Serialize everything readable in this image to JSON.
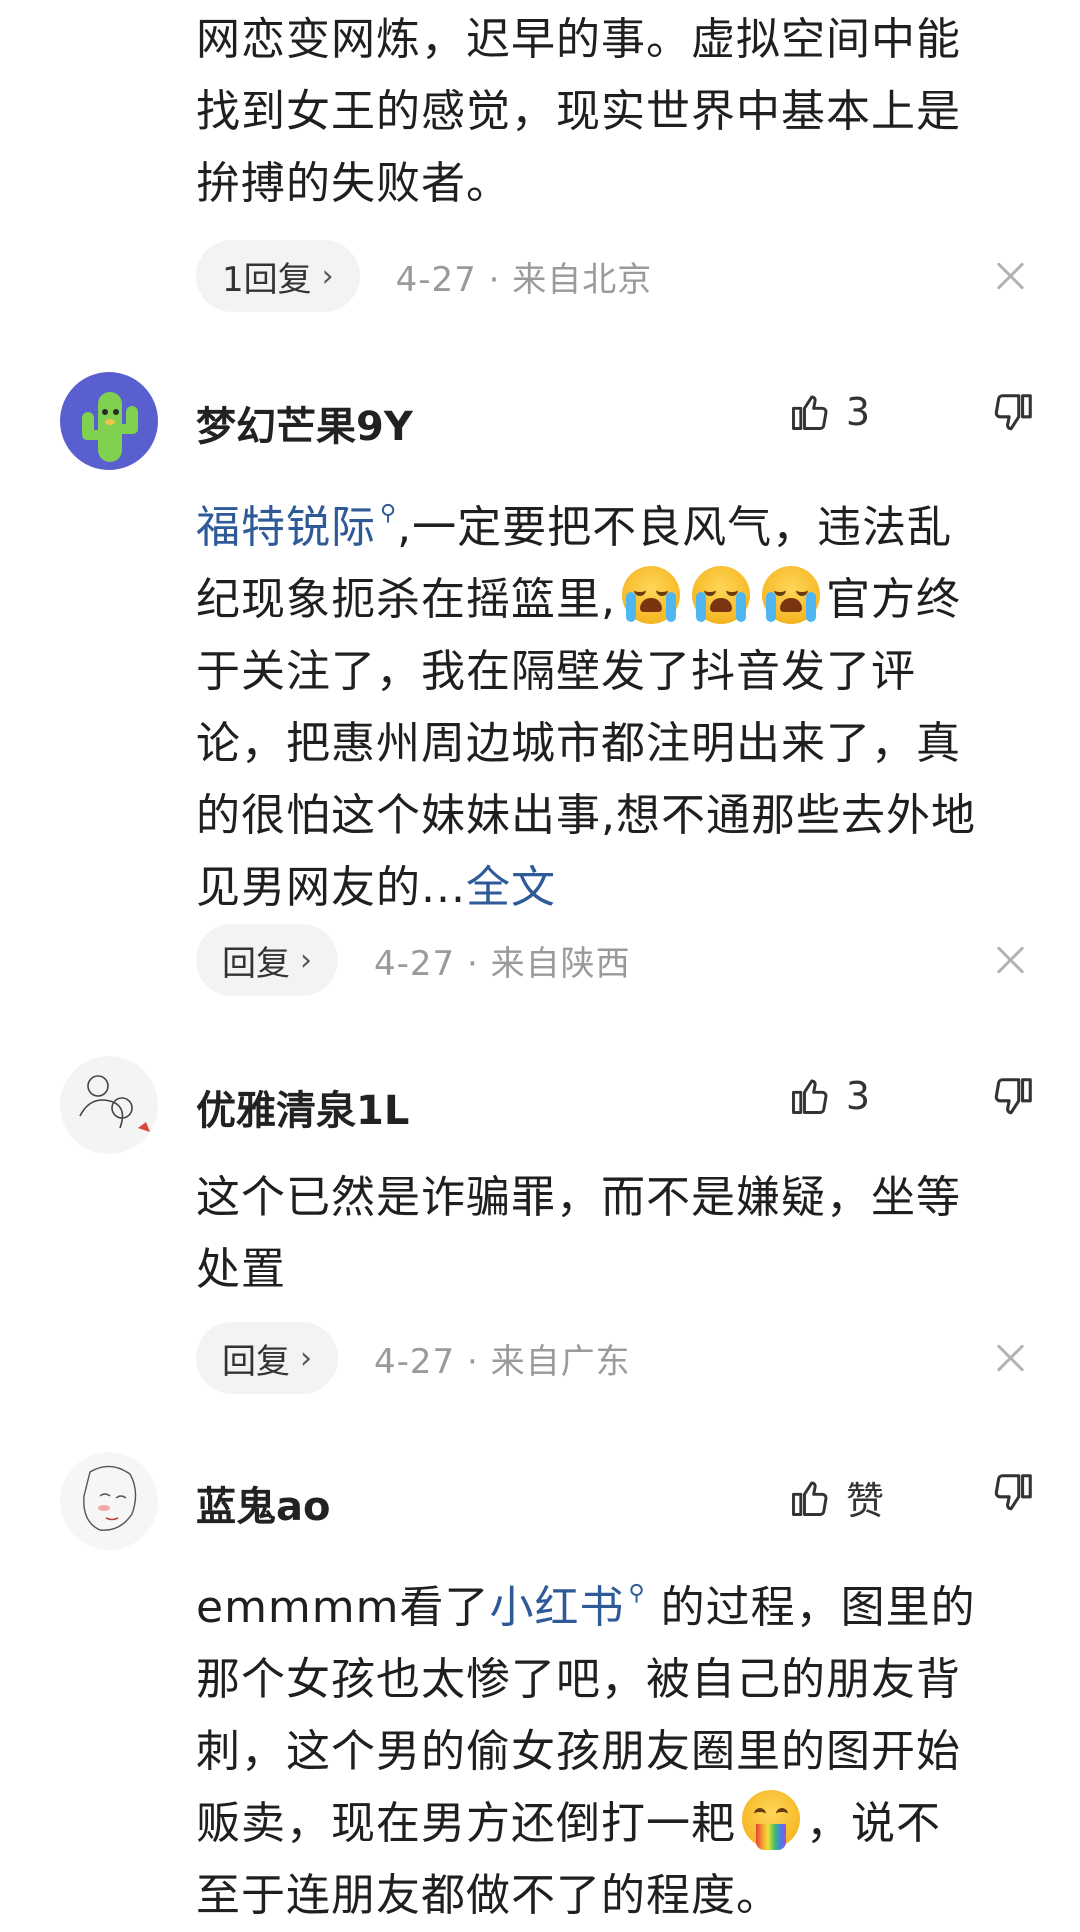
{
  "top_comment": {
    "lines": [
      "网恋变网炼，迟早的事。虚拟空间中能",
      "找到女王的感觉，现实世界中基本上是",
      "拚搏的失败者。"
    ],
    "reply_label": "1回复",
    "meta": "4-27 · 来自北京"
  },
  "comments": [
    {
      "username": "梦幻芒果9Y",
      "likes": "3",
      "link_text": "福特锐际",
      "line1_rest": ",一定要把不良风气，违法乱",
      "line2_pre": "纪现象扼杀在摇篮里,",
      "line2_post": "官方终",
      "line3": "于关注了，我在隔壁发了抖音发了评",
      "line4": "论，把惠州周边城市都注明出来了，真",
      "line5": "的很怕这个妹妹出事,想不通那些去外地",
      "line6_pre": "见男网友的...",
      "full_text_label": "全文",
      "reply_label": "回复",
      "meta": "4-27 · 来自陕西"
    },
    {
      "username": "优雅清泉1L",
      "likes": "3",
      "line1": "这个已然是诈骗罪，而不是嫌疑，坐等",
      "line2": "处置",
      "reply_label": "回复",
      "meta": "4-27 · 来自广东"
    },
    {
      "username": "蓝鬼ao",
      "likes": "赞",
      "line1_pre": "emmmm看了",
      "link_text": "小红书",
      "line1_post": " 的过程，图里的",
      "line2": "那个女孩也太惨了吧，被自己的朋友背",
      "line3": "刺，这个男的偷女孩朋友圈里的图开始",
      "line4_pre": "贩卖，现在男方还倒打一耙",
      "line4_post": "，说不",
      "line5": "至于连朋友都做不了的程度。"
    }
  ],
  "icons": {
    "like": "thumbs-up-icon",
    "dislike": "thumbs-down-icon",
    "close": "close-icon",
    "search": "search-icon",
    "chevron": "chevron-right-icon"
  },
  "colors": {
    "link": "#2f5a98",
    "meta": "#9a9a9a",
    "pill_bg": "#f3f3f3"
  }
}
